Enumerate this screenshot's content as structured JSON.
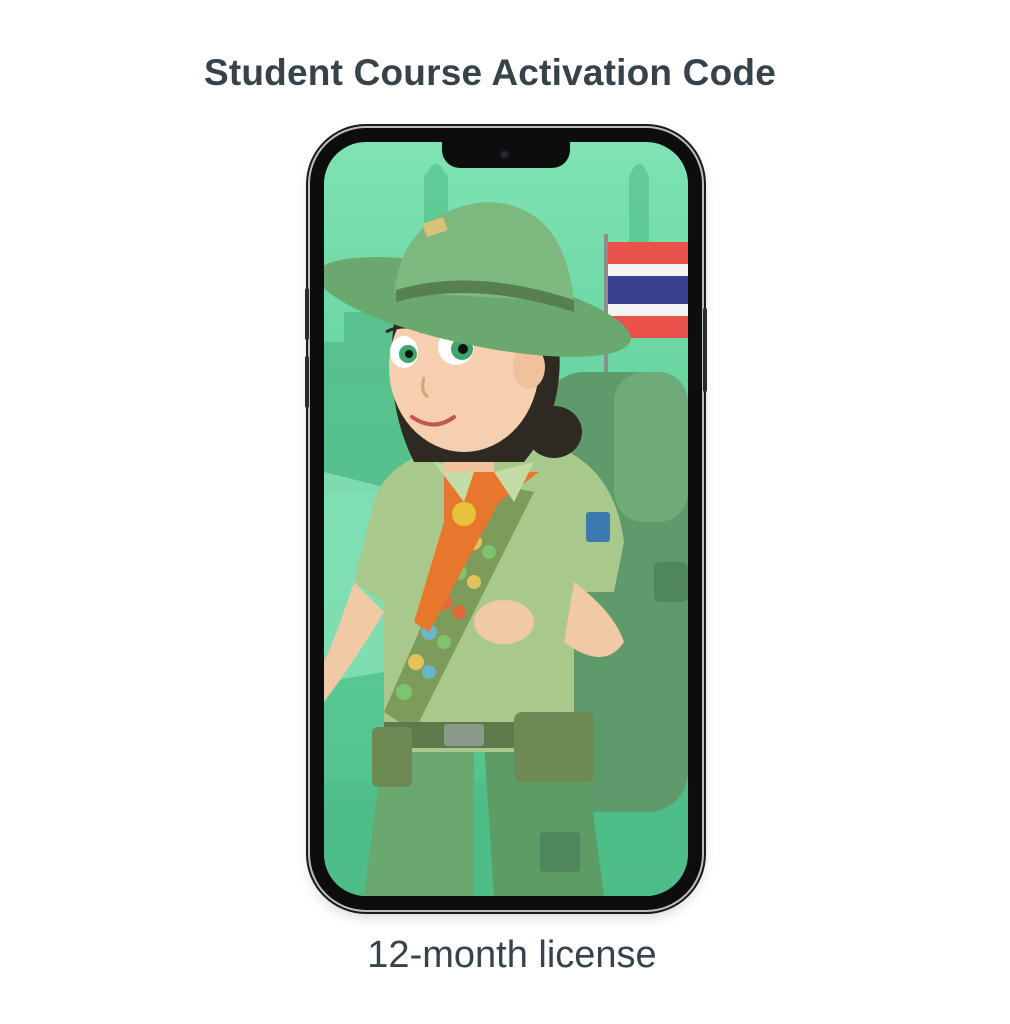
{
  "header": {
    "title": "Student Course Activation Code"
  },
  "product": {
    "image_alt": "Illustrated girl scout with green hat, orange neckerchief, badge sash and backpack beside a Thai flag",
    "caption": "12-month license"
  },
  "colors": {
    "title_text": "#36434a",
    "screen_background": "#6ad8a6",
    "uniform_green": "#8fbf73",
    "neckerchief_orange": "#e8772e",
    "phone_frame": "#0d0d0d"
  }
}
